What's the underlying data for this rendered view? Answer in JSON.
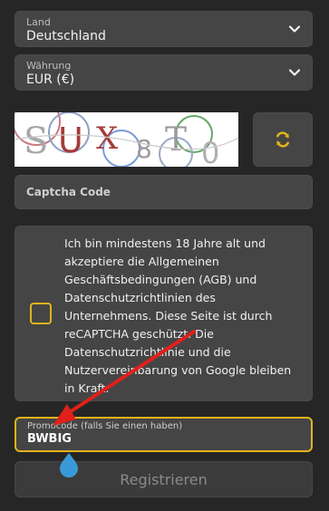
{
  "country": {
    "label": "Land",
    "value": "Deutschland",
    "icon": "chevron-down-icon"
  },
  "currency": {
    "label": "Währung",
    "value": "EUR (€)",
    "icon": "chevron-down-icon"
  },
  "captcha": {
    "image_text": "SUX8T0",
    "refresh_icon": "refresh-icon",
    "input_placeholder": "Captcha Code"
  },
  "terms": {
    "text": "Ich bin mindestens 18 Jahre alt und akzeptiere die Allgemeinen Geschäftsbedingungen (AGB) und Datenschutzrichtlinien des Unternehmens. Diese Seite ist durch reCAPTCHA geschützt. Die Datenschutzrichtlinie und die Nutzervereinbarung von Google bleiben in Kraft."
  },
  "promo": {
    "label": "Promocode (falls Sie einen haben)",
    "value": "BWBIG"
  },
  "register": {
    "label": "Registrieren"
  },
  "colors": {
    "accent": "#e1b31d",
    "annotation_arrow": "#e0201a",
    "cursor": "#3a9ad9"
  }
}
